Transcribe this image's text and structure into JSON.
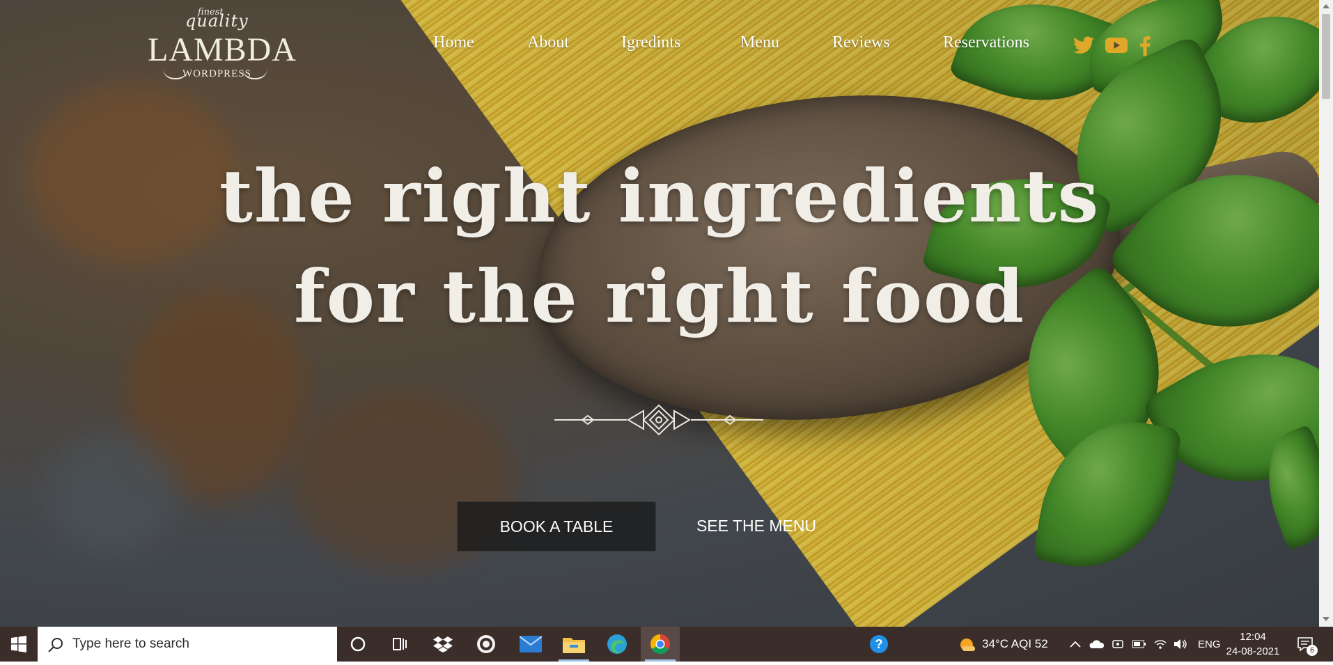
{
  "logo": {
    "finest": "finest",
    "quality": "quality",
    "brand": "LAMBDA",
    "wordpress": "WORDPRESS"
  },
  "nav": {
    "items": [
      "Home",
      "About",
      "Igredints",
      "Menu",
      "Reviews",
      "Reservations"
    ]
  },
  "social": {
    "icons": [
      "twitter-icon",
      "youtube-icon",
      "facebook-icon"
    ],
    "color": "#e0a829"
  },
  "hero": {
    "line1": "the right ingredients",
    "line2": "for the right food",
    "book_label": "BOOK A TABLE",
    "menu_label": "SEE THE MENU"
  },
  "taskbar": {
    "search_placeholder": "Type here to search",
    "weather": "34°C  AQI 52",
    "language": "ENG",
    "time": "12:04",
    "date": "24-08-2021",
    "notifications": "6",
    "apps": [
      "cortana-icon",
      "task-view-icon",
      "dropbox-icon",
      "app-icon",
      "mail-icon",
      "file-explorer-icon",
      "edge-icon",
      "chrome-icon"
    ]
  }
}
